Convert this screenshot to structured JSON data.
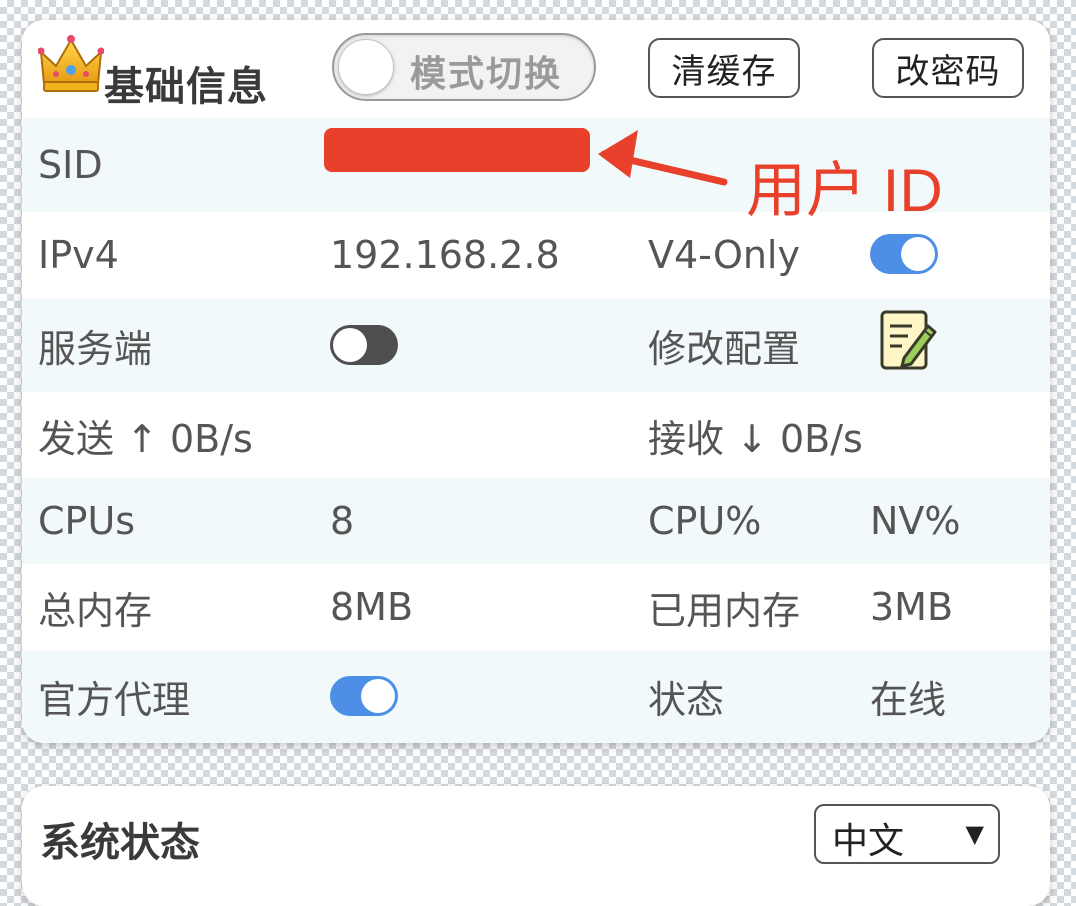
{
  "info_card": {
    "title": "基础信息",
    "mode_toggle_label": "模式切换",
    "clear_cache_label": "清缓存",
    "change_password_label": "改密码"
  },
  "rows": {
    "sid_label": "SID",
    "ipv4_label": "IPv4",
    "ipv4_value": "192.168.2.8",
    "v4only_label": "V4-Only",
    "server_label": "服务端",
    "edit_config_label": "修改配置",
    "send_label": "发送 ↑ 0B/s",
    "recv_label": "接收 ↓ 0B/s",
    "cpus_label": "CPUs",
    "cpus_value": "8",
    "cpu_pct_label": "CPU%",
    "nv_pct_label": "NV%",
    "total_mem_label": "总内存",
    "total_mem_value": "8MB",
    "used_mem_label": "已用内存",
    "used_mem_value": "3MB",
    "proxy_label": "官方代理",
    "status_label": "状态",
    "status_value": "在线"
  },
  "toggles": {
    "mode": false,
    "v4only": true,
    "server": false,
    "proxy": true
  },
  "annotation": {
    "text": "用户 ID",
    "color": "#e8402a"
  },
  "status_card": {
    "title": "系统状态",
    "language_selected": "中文"
  },
  "colors": {
    "toggle_on": "#4d8fe6",
    "toggle_off": "#4f4f4f",
    "row_shade": "#f2f9fb",
    "redaction": "#e8402a"
  },
  "icons": {
    "header": "crown-icon",
    "edit_config": "edit-note-icon",
    "dropdown": "caret-down-icon"
  }
}
